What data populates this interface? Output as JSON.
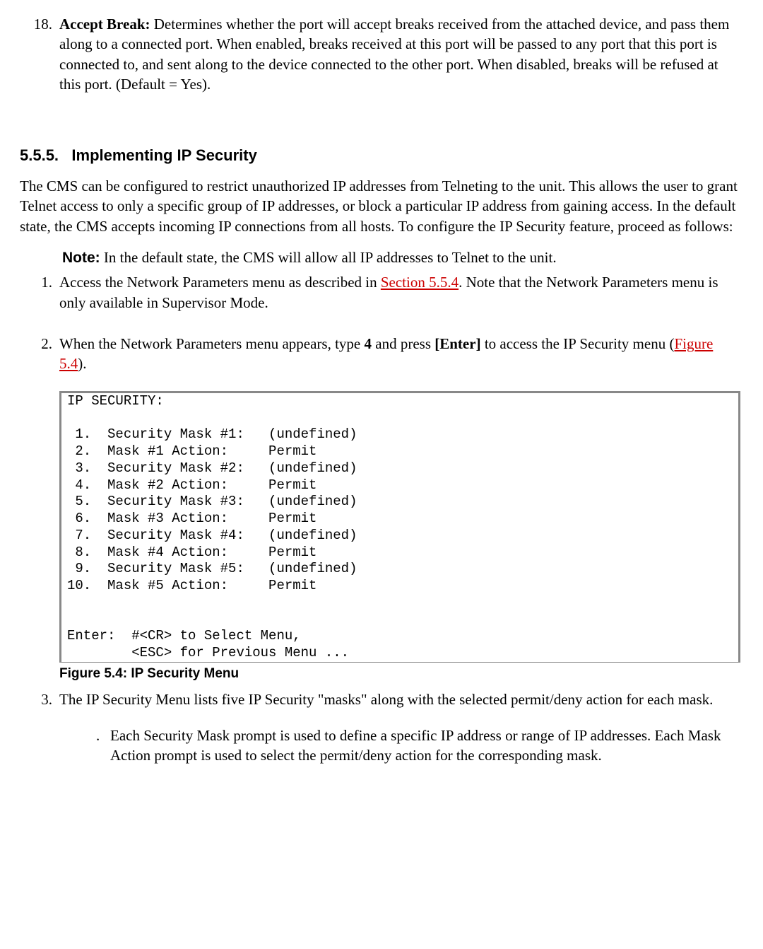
{
  "item18": {
    "num": "18.",
    "title": "Accept Break:  ",
    "body": "Determines whether the port will accept breaks received from the attached device, and pass them along to a connected port. When enabled, breaks received at this port will be passed to any port that this port is connected to, and sent along to the device connected to the other port. When disabled, breaks will be refused at this port. (Default = Yes)."
  },
  "section": {
    "number": "5.5.5.",
    "title": "Implementing IP Security"
  },
  "intro": "The CMS can be configured to restrict unauthorized IP addresses from Telneting to the unit. This allows the user to grant Telnet access to only a specific group of IP addresses, or block a particular IP address from gaining access. In the default state, the CMS accepts incoming IP connections from all hosts. To configure the IP Security feature, proceed as follows:",
  "note": {
    "label": "Note:",
    "text": "  In the default state, the CMS will allow all IP addresses to Telnet to the unit."
  },
  "step1": {
    "num": "1.",
    "part1": "Access the Network Parameters menu as described in ",
    "link": "Section 5.5.4",
    "part2": ". Note that the Network Parameters menu is only available in Supervisor Mode."
  },
  "step2": {
    "num": "2.",
    "part1": "When the Network Parameters menu appears, type ",
    "bold1": "4",
    "part2": " and press ",
    "bold2": "[Enter]",
    "part3": " to access the IP Security menu (",
    "link": "Figure 5.4",
    "part4": ")."
  },
  "codebox": "IP SECURITY:\n\n 1.  Security Mask #1:   (undefined)\n 2.  Mask #1 Action:     Permit\n 3.  Security Mask #2:   (undefined)\n 4.  Mask #2 Action:     Permit\n 5.  Security Mask #3:   (undefined)\n 6.  Mask #3 Action:     Permit\n 7.  Security Mask #4:   (undefined)\n 8.  Mask #4 Action:     Permit\n 9.  Security Mask #5:   (undefined)\n10.  Mask #5 Action:     Permit\n\n\nEnter:  #<CR> to Select Menu,\n        <ESC> for Previous Menu ...",
  "figure": "Figure 5.4:  IP Security Menu",
  "step3": {
    "num": "3.",
    "text": "The IP Security Menu lists five IP Security \"masks\" along with the selected permit/deny action for each mask."
  },
  "subitem": {
    "dot": ".",
    "text": "Each Security Mask prompt is used to define a specific IP address or range of IP addresses. Each Mask Action prompt is used to select the permit/deny action for the corresponding mask."
  }
}
